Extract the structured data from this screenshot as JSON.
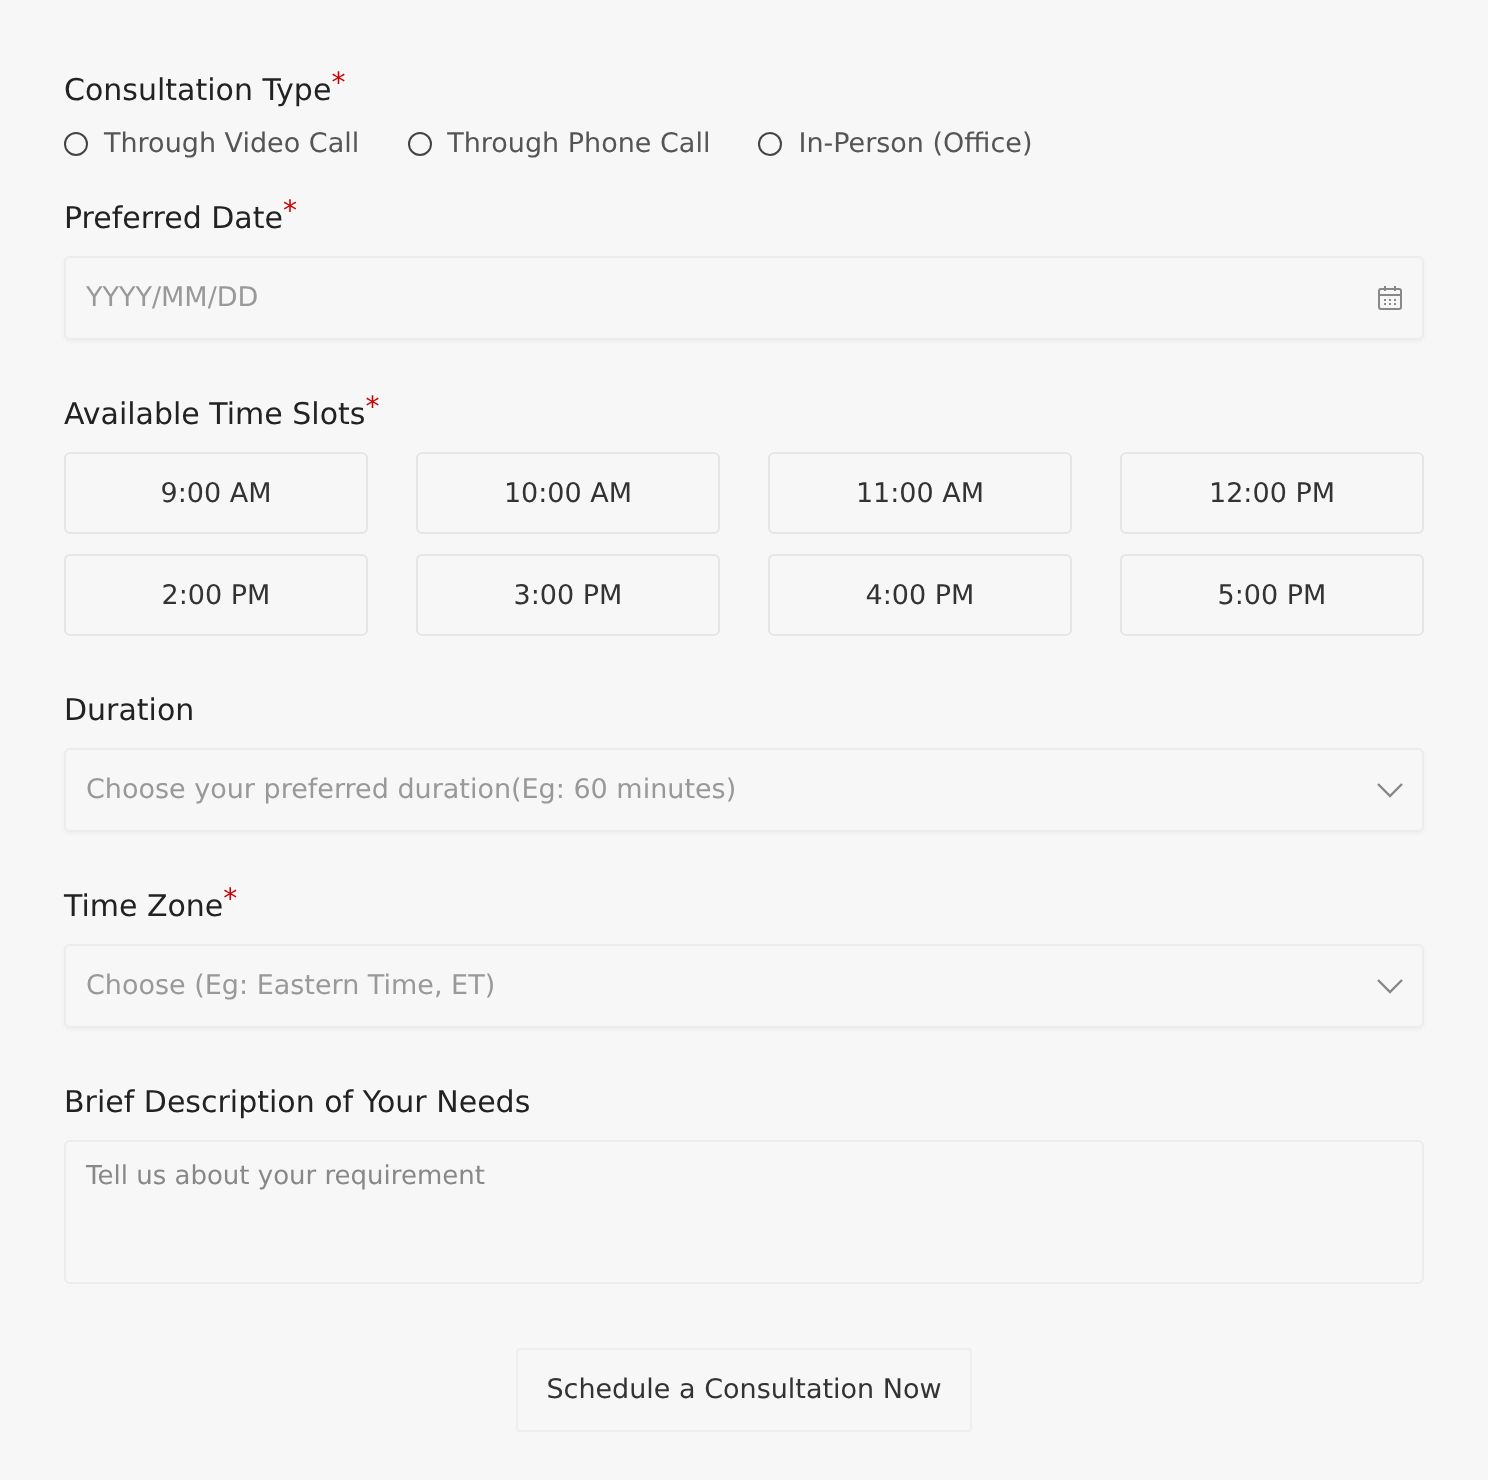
{
  "sections": [
    {
      "kind": "radio",
      "label": "Consultation Type",
      "required_mark": "*",
      "options": [
        {
          "label": "Through Video Call",
          "selected": false
        },
        {
          "label": "Through Phone Call",
          "selected": false
        },
        {
          "label": "In-Person (Office)",
          "selected": false
        }
      ]
    },
    {
      "kind": "date",
      "label": "Preferred Date",
      "required_mark": "*",
      "placeholder": "YYYY/MM/DD"
    },
    {
      "kind": "slots",
      "label": "Available Time Slots",
      "required_mark": "*",
      "options": [
        {
          "label": "9:00 AM",
          "selected": false
        },
        {
          "label": "10:00 AM",
          "selected": false
        },
        {
          "label": "11:00 AM",
          "selected": false
        },
        {
          "label": "12:00 PM",
          "selected": false
        },
        {
          "label": "2:00 PM",
          "selected": false
        },
        {
          "label": "3:00 PM",
          "selected": false
        },
        {
          "label": "4:00 PM",
          "selected": false
        },
        {
          "label": "5:00 PM",
          "selected": false
        }
      ]
    },
    {
      "kind": "select",
      "label": "Duration",
      "placeholder": "Choose your preferred duration(Eg: 60 minutes)"
    },
    {
      "kind": "select",
      "label": "Time Zone",
      "required_mark": "*",
      "placeholder": "Choose (Eg: Eastern Time, ET)"
    },
    {
      "kind": "textarea",
      "label": "Brief Description of Your Needs",
      "placeholder": "Tell us about your requirement"
    }
  ],
  "submit": {
    "label": "Schedule a Consultation Now"
  }
}
